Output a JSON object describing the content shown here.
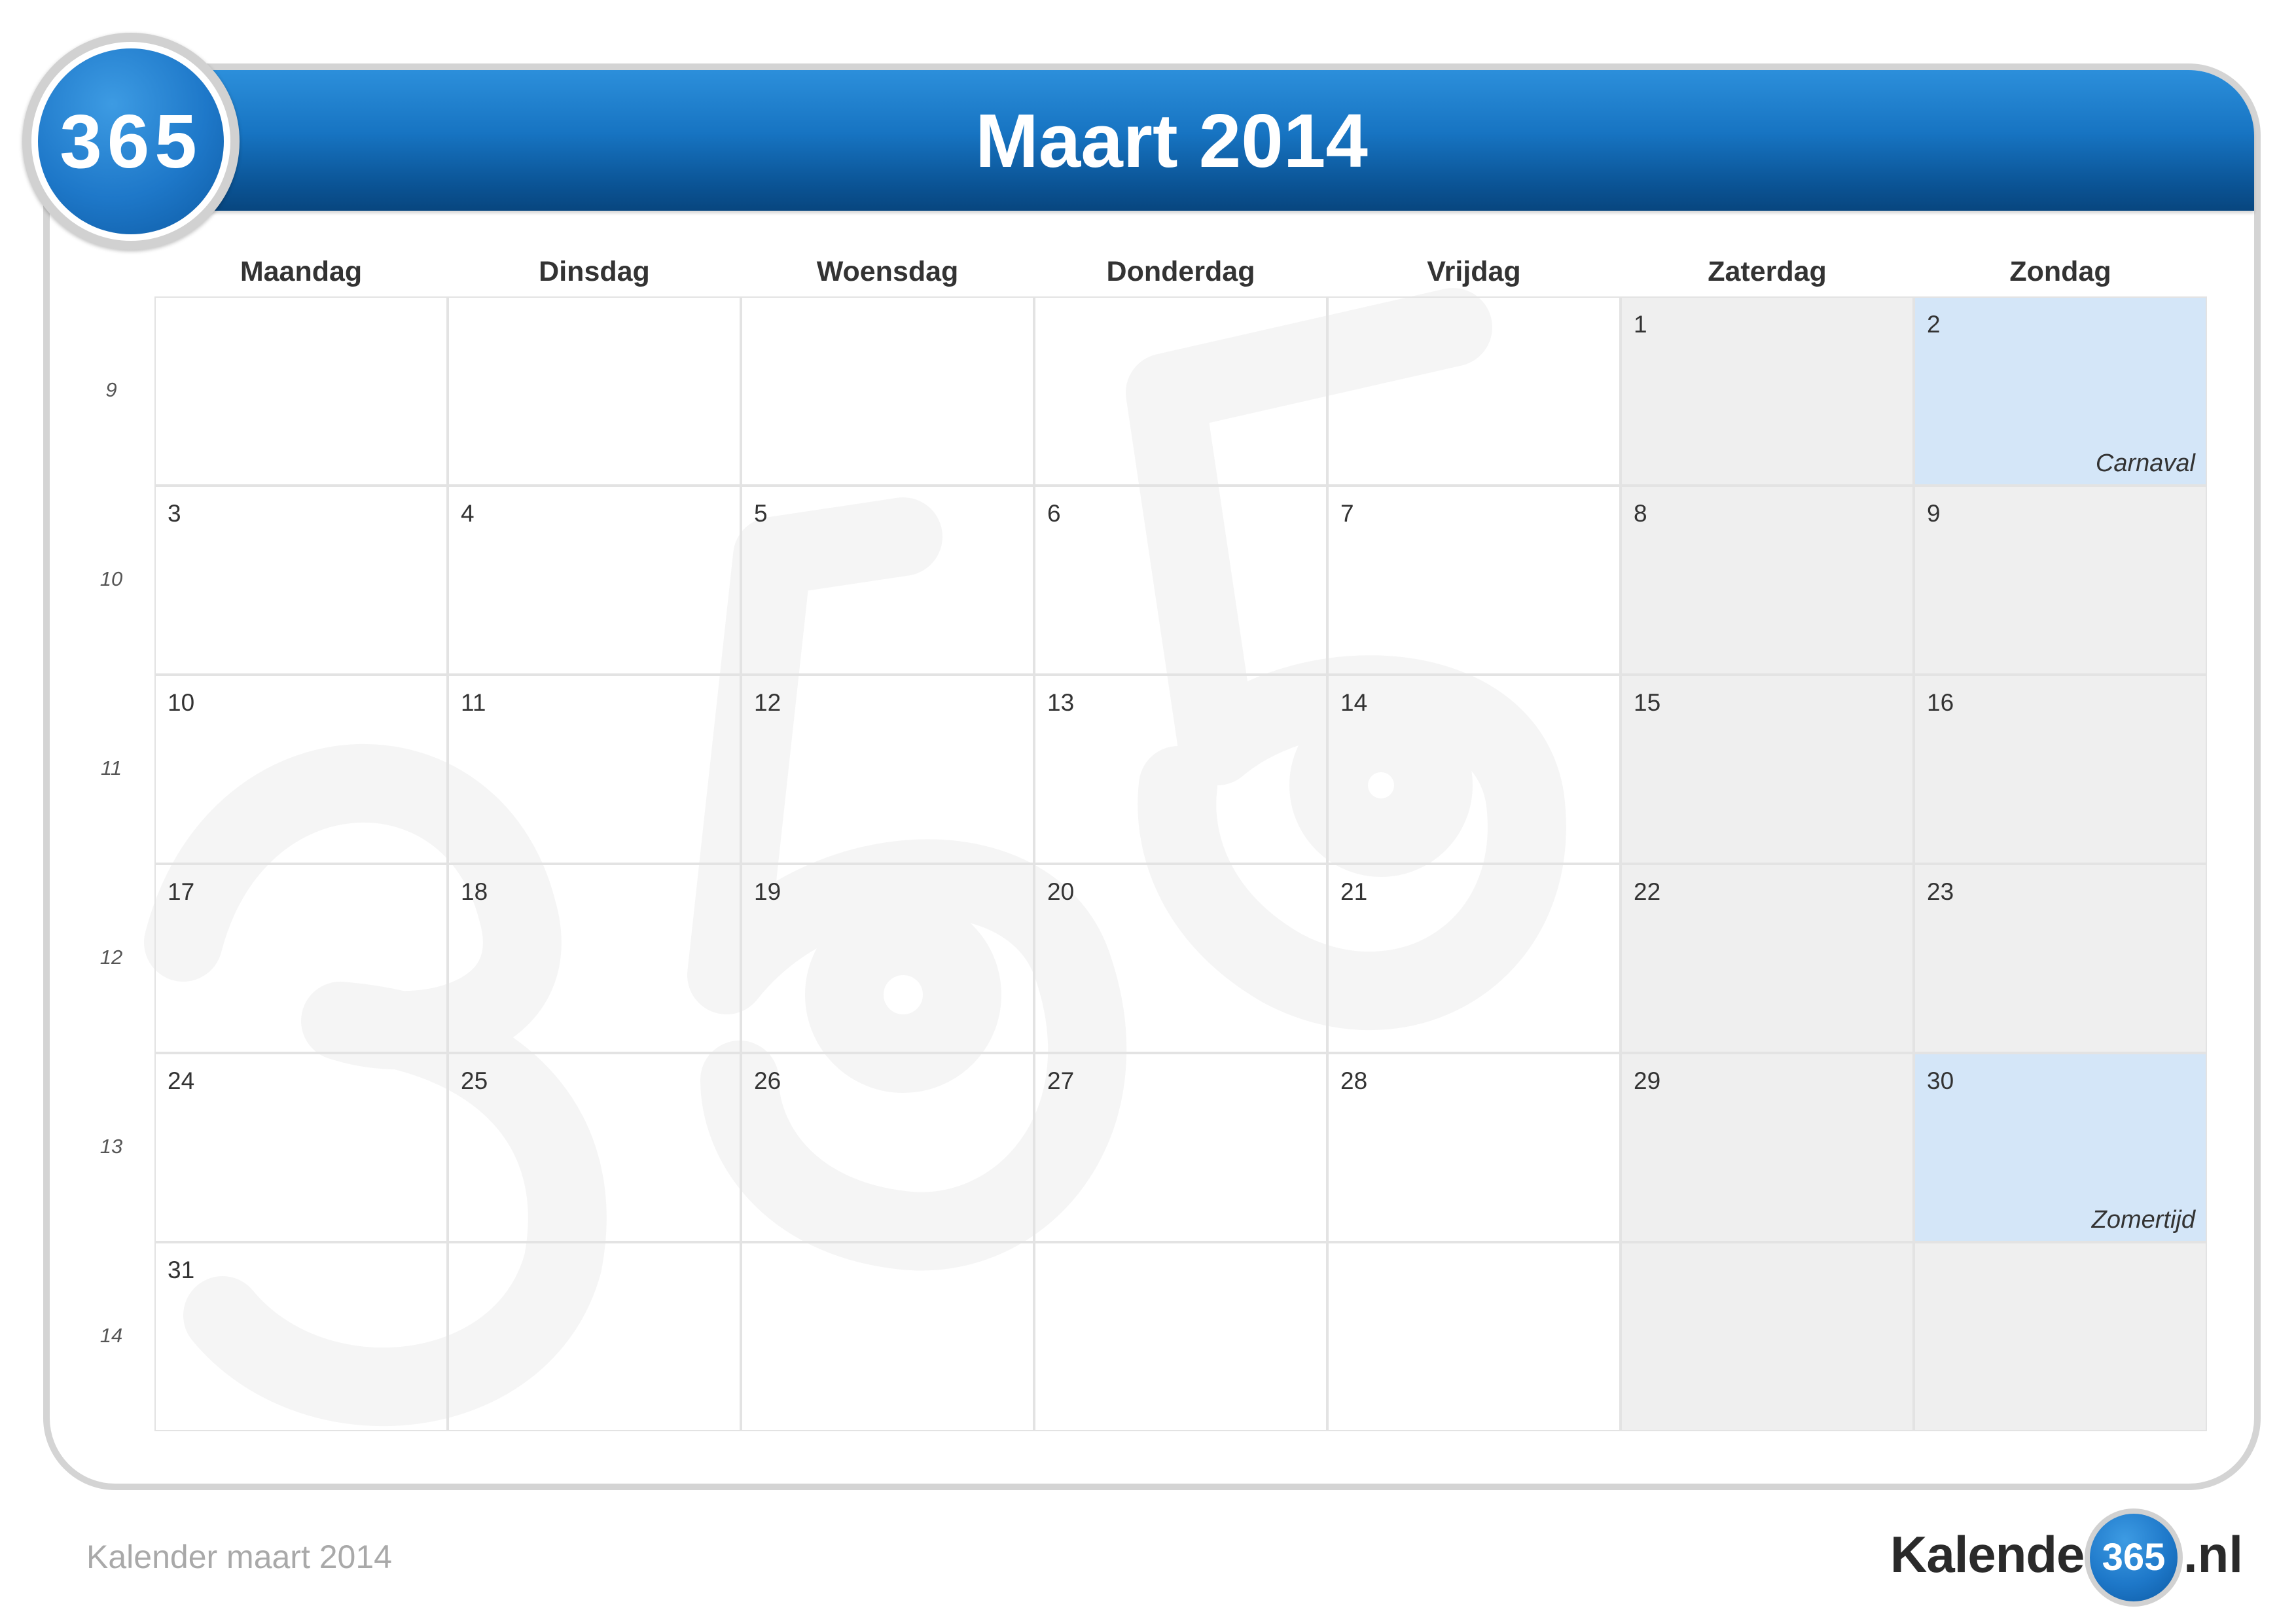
{
  "header": {
    "logo_text": "365",
    "title": "Maart 2014"
  },
  "weekdays": [
    "Maandag",
    "Dinsdag",
    "Woensdag",
    "Donderdag",
    "Vrijdag",
    "Zaterdag",
    "Zondag"
  ],
  "weeks": [
    {
      "number": "9",
      "days": [
        "",
        "",
        "",
        "",
        "",
        "1",
        "2"
      ]
    },
    {
      "number": "10",
      "days": [
        "3",
        "4",
        "5",
        "6",
        "7",
        "8",
        "9"
      ]
    },
    {
      "number": "11",
      "days": [
        "10",
        "11",
        "12",
        "13",
        "14",
        "15",
        "16"
      ]
    },
    {
      "number": "12",
      "days": [
        "17",
        "18",
        "19",
        "20",
        "21",
        "22",
        "23"
      ]
    },
    {
      "number": "13",
      "days": [
        "24",
        "25",
        "26",
        "27",
        "28",
        "29",
        "30"
      ]
    },
    {
      "number": "14",
      "days": [
        "31",
        "",
        "",
        "",
        "",
        "",
        ""
      ]
    }
  ],
  "events": {
    "carnaval": "Carnaval",
    "zomertijd": "Zomertijd"
  },
  "footer": {
    "caption": "Kalender maart 2014",
    "brand_left": "Kalender",
    "brand_number": "365",
    "brand_right": ".nl"
  },
  "colors": {
    "header_blue": "#1774c2",
    "holiday": "#d4e6f8",
    "weekend": "#ececec"
  }
}
